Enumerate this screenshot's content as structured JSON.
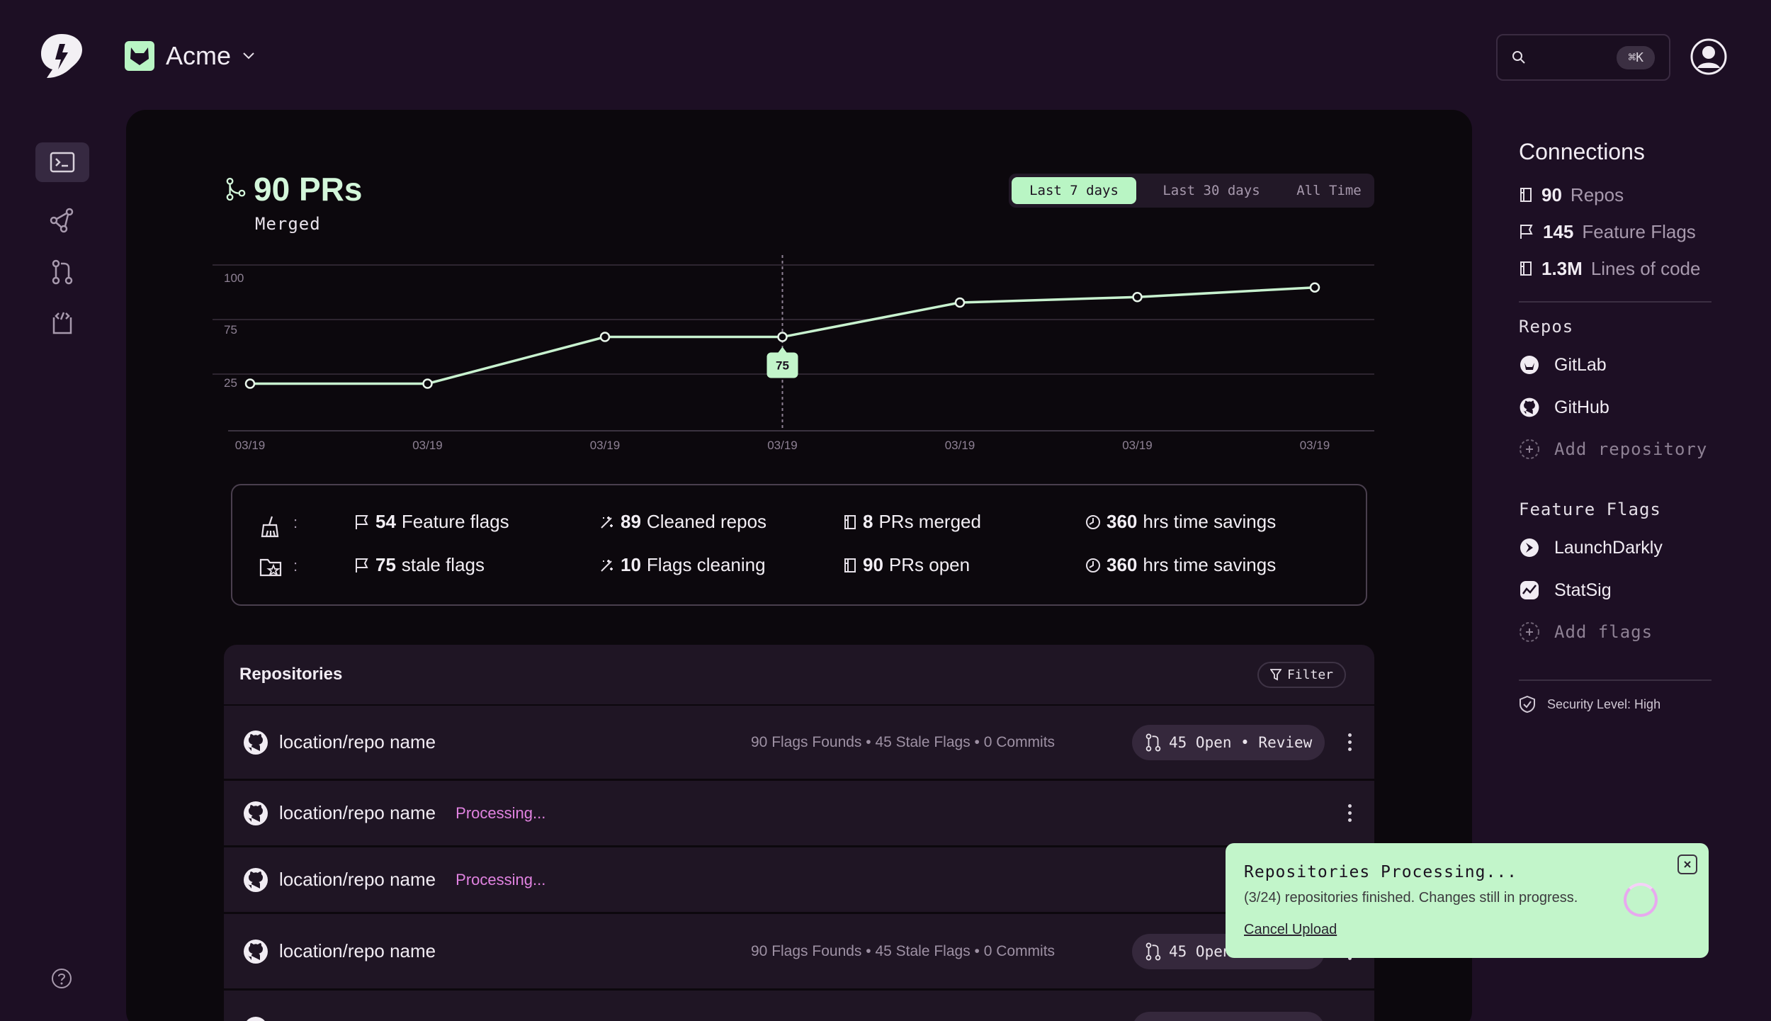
{
  "org": {
    "name": "Acme",
    "icon": "gitlab-fox-icon"
  },
  "search": {
    "shortcut": "⌘K"
  },
  "prs": {
    "count": "90 PRs",
    "label": "Merged"
  },
  "range": {
    "options": [
      "Last 7 days",
      "Last 30 days",
      "All Time"
    ],
    "selected": "Last 7 days"
  },
  "chart_data": {
    "type": "line",
    "x": [
      "03/19",
      "03/19",
      "03/19",
      "03/19",
      "03/19",
      "03/19",
      "03/19"
    ],
    "values": [
      25,
      25,
      59,
      59,
      84,
      88,
      95
    ],
    "yticks": [
      "100",
      "75",
      "25"
    ],
    "ylim": [
      0,
      100
    ],
    "highlight": {
      "index": 3,
      "label": "75"
    },
    "grid": true,
    "color": "#c8f2cf"
  },
  "stats": {
    "row1": [
      {
        "num": "54",
        "label": "Feature flags"
      },
      {
        "num": "89",
        "label": "Cleaned repos"
      },
      {
        "num": "8",
        "label": "PRs merged"
      },
      {
        "num": "360",
        "label": "hrs time savings"
      }
    ],
    "row2": [
      {
        "num": "75",
        "label": "stale flags"
      },
      {
        "num": "10",
        "label": "Flags cleaning"
      },
      {
        "num": "90",
        "label": "PRs open"
      },
      {
        "num": "360",
        "label": "hrs time savings"
      }
    ],
    "sep": ":"
  },
  "repos": {
    "title": "Repositories",
    "filter": "Filter",
    "rows": [
      {
        "name": "location/repo name",
        "meta": "90 Flags  Founds  •  45 Stale Flags  •  0 Commits",
        "pill": "45 Open • Review",
        "status": ""
      },
      {
        "name": "location/repo name",
        "meta": "",
        "pill": "",
        "status": "Processing..."
      },
      {
        "name": "location/repo name",
        "meta": "",
        "pill": "",
        "status": "Processing..."
      },
      {
        "name": "location/repo name",
        "meta": "90 Flags  Founds  •  45 Stale Flags  •  0 Commits",
        "pill": "45 Open • Review",
        "status": ""
      }
    ]
  },
  "connections": {
    "title": "Connections",
    "items": [
      {
        "num": "90",
        "label": "Repos"
      },
      {
        "num": "145",
        "label": "Feature Flags"
      },
      {
        "num": "1.3M",
        "label": "Lines of code"
      }
    ]
  },
  "repo_sources": {
    "title": "Repos",
    "items": [
      "GitLab",
      "GitHub"
    ],
    "add": "Add repository"
  },
  "flag_sources": {
    "title": "Feature Flags",
    "items": [
      "LaunchDarkly",
      "StatSig"
    ],
    "add": "Add flags"
  },
  "security": "Security Level: High",
  "toast": {
    "title": "Repositories Processing...",
    "message": "(3/24) repositories finished. Changes still in progress.",
    "cancel": "Cancel Upload"
  }
}
